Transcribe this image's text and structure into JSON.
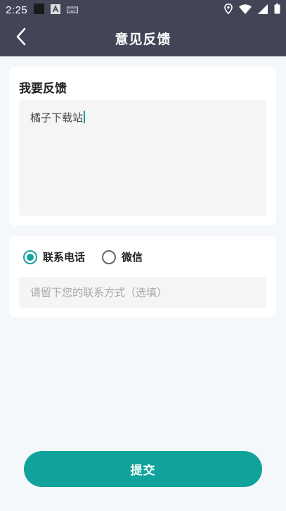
{
  "status_bar": {
    "time": "2:25",
    "icons": [
      "square-notification-icon",
      "android-a-icon",
      "keyboard-icon",
      "location-icon",
      "wifi-icon",
      "signal-icon",
      "battery-icon"
    ]
  },
  "header": {
    "title": "意见反馈",
    "back_icon": "chevron-left-icon"
  },
  "feedback": {
    "label": "我要反馈",
    "value": "橘子下载站"
  },
  "contact": {
    "options": [
      {
        "label": "联系电话",
        "selected": true
      },
      {
        "label": "微信",
        "selected": false
      }
    ],
    "placeholder": "请留下您的联系方式（选填）",
    "value": ""
  },
  "submit": {
    "label": "提交"
  },
  "colors": {
    "header_bg": "#434557",
    "accent": "#11a39b",
    "page_bg": "#f4f8fb",
    "field_bg": "#f5f5f5"
  }
}
